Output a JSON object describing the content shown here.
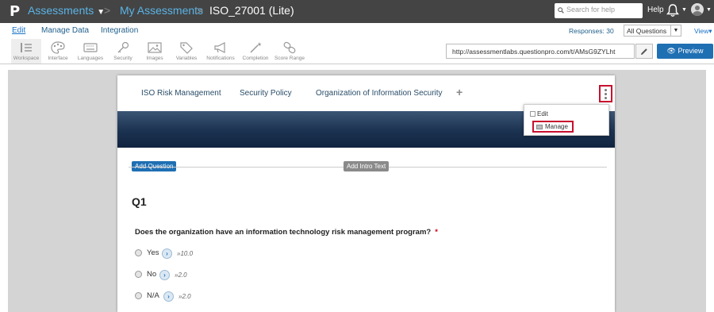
{
  "topbar": {
    "logo": "P",
    "breadcrumb": [
      "Assessments",
      "My Assessments",
      "ISO_27001 (Lite)"
    ],
    "separator": ">",
    "search_placeholder": "Search for help",
    "help": "Help"
  },
  "menubar": {
    "items": [
      "Edit",
      "Manage Data",
      "Integration"
    ],
    "responses": "Responses: 30",
    "question_filter": "All Questions",
    "view": "View"
  },
  "toolbar": {
    "tools": [
      "Workspace",
      "Interface",
      "Languages",
      "Security",
      "Images",
      "Variables",
      "Notifications",
      "Completion",
      "Score Range"
    ],
    "url": "http://assessmentlabs.questionpro.com/t/AMsG9ZYLht",
    "preview": "Preview"
  },
  "pages": {
    "tabs": [
      "ISO Risk Management",
      "Security Policy",
      "Organization of Information Security"
    ],
    "add": "+"
  },
  "popup_menu": {
    "items": [
      "Edit",
      "Manage"
    ]
  },
  "editor": {
    "add_question": "Add Question",
    "add_intro_text": "Add Intro Text",
    "question_number": "Q1",
    "question_text": "Does the organization have an information technology risk management program?",
    "required_marker": "*",
    "options": [
      {
        "label": "Yes",
        "score": "»10.0"
      },
      {
        "label": "No",
        "score": "»2.0"
      },
      {
        "label": "N/A",
        "score": "»2.0"
      }
    ]
  },
  "colors": {
    "topbar": "#444444",
    "link": "#5ab4e6",
    "primary_button": "#1f6fb3",
    "highlight": "#c8102e",
    "banner": "#1b3250"
  }
}
